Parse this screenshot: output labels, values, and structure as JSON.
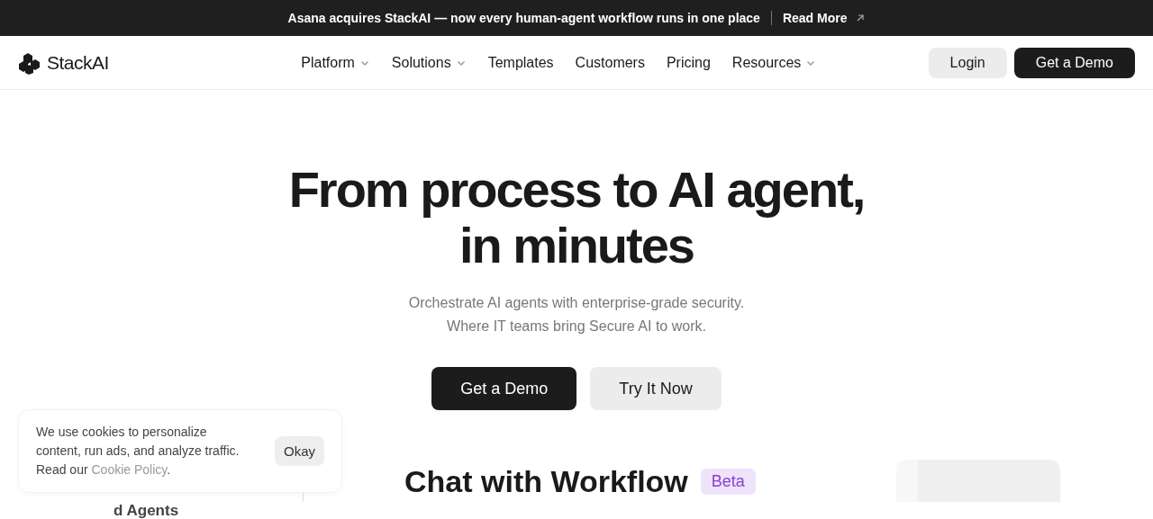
{
  "announcement": {
    "text": "Asana acquires StackAI — now every human-agent workflow runs in one place",
    "link": "Read More"
  },
  "nav": {
    "logo": "StackAI",
    "items": [
      {
        "label": "Platform",
        "dropdown": true
      },
      {
        "label": "Solutions",
        "dropdown": true
      },
      {
        "label": "Templates",
        "dropdown": false
      },
      {
        "label": "Customers",
        "dropdown": false
      },
      {
        "label": "Pricing",
        "dropdown": false
      },
      {
        "label": "Resources",
        "dropdown": true
      }
    ],
    "login": "Login",
    "demo": "Get a Demo"
  },
  "hero": {
    "title_lines": [
      "From process to AI agent,",
      "in minutes"
    ],
    "subtitle_lines": [
      "Orchestrate AI agents with enterprise-grade security.",
      "Where IT teams bring Secure AI to work."
    ],
    "primary": "Get a Demo",
    "secondary": "Try It Now"
  },
  "preview": {
    "side_label": "d Agents",
    "heading": "Chat with Workflow",
    "badge": "Beta"
  },
  "cookie": {
    "text": "We use cookies to personalize content, run ads, and analyze traffic. Read our",
    "link": "Cookie Policy",
    "end": ".",
    "button": "Okay"
  }
}
